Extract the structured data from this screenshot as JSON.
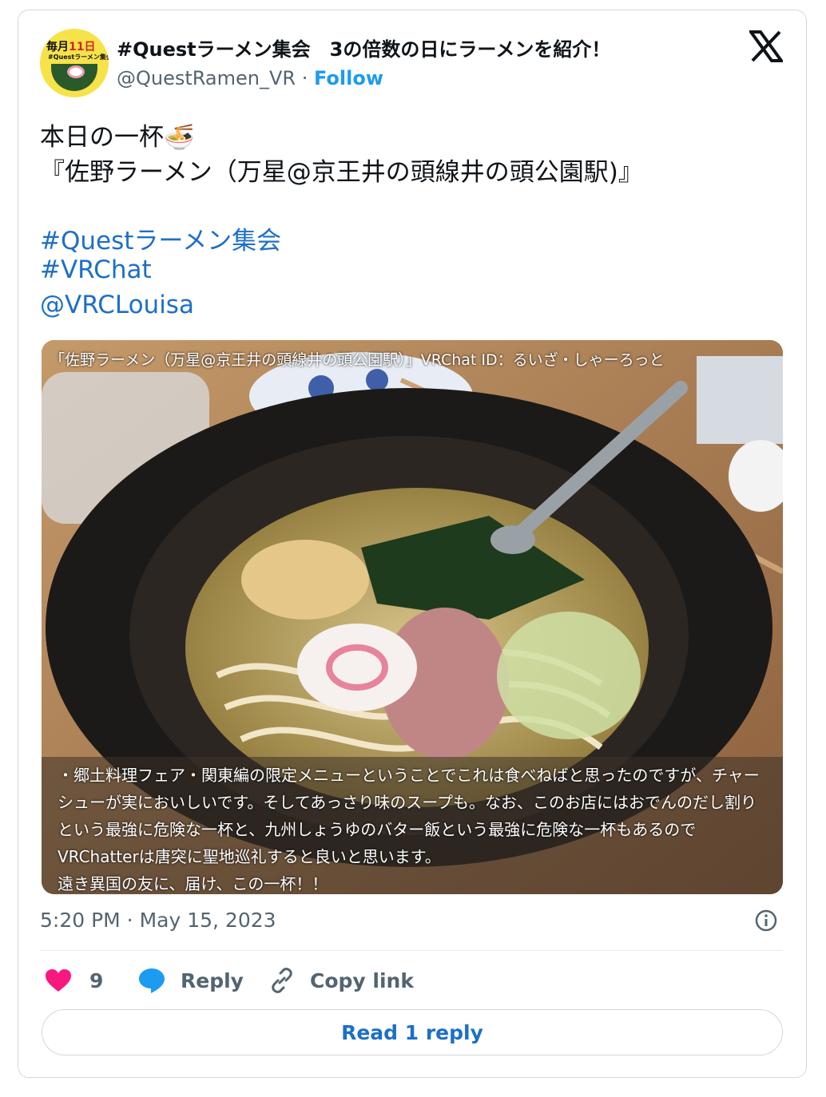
{
  "author": {
    "avatar": {
      "top_text_a": "毎月",
      "top_text_b": "11日",
      "mid_text": "#Questラーメン集会"
    },
    "name": "#Questラーメン集会　3の倍数の日にラーメンを紹介！",
    "handle": "@QuestRamen_VR",
    "separator": " · ",
    "follow_label": "Follow"
  },
  "post": {
    "line1": "本日の一杯🍜",
    "line2": "『佐野ラーメン（万星@京王井の頭線井の頭公園駅)』",
    "tags": [
      "#Questラーメン集会",
      "#VRChat",
      "@VRCLouisa"
    ]
  },
  "photo": {
    "caption_top": "「佐野ラーメン（万星@京王井の頭線井の頭公園駅）」VRChat ID：るいざ・しゃーろっと",
    "caption_bottom": "・郷土料理フェア・関東編の限定メニューということでこれは食べねばと思ったのですが、チャーシューが実においしいです。そしてあっさり味のスープも。なお、このお店にはおでんのだし割りという最強に危険な一杯と、九州しょうゆのバター飯という最強に危険な一杯もあるのでVRChatterは唐突に聖地巡礼すると良いと思います。\n遠き異国の友に、届け、この一杯！！"
  },
  "meta": {
    "timestamp": "5:20 PM · May 15, 2023"
  },
  "actions": {
    "like_count": "9",
    "reply_label": "Reply",
    "copy_link_label": "Copy link"
  },
  "read_reply_label": "Read 1 reply",
  "colors": {
    "link": "#1d6fc7",
    "follow": "#1d9bf0",
    "like": "#f91880",
    "reply": "#1d9bf0"
  }
}
